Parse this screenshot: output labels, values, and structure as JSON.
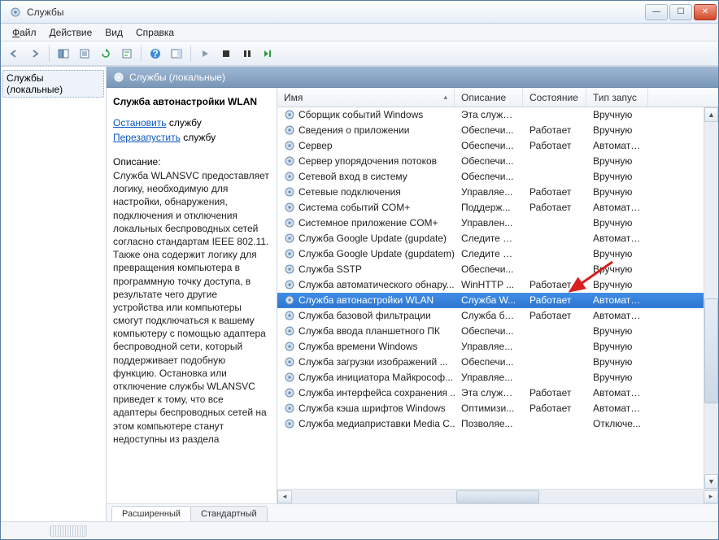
{
  "window": {
    "title": "Службы"
  },
  "menu": {
    "file": "Файл",
    "action": "Действие",
    "view": "Вид",
    "help": "Справка"
  },
  "tree": {
    "node": "Службы (локальные)"
  },
  "header": {
    "title": "Службы (локальные)"
  },
  "detail": {
    "title": "Служба автонастройки WLAN",
    "stop_link": "Остановить",
    "stop_suffix": " службу",
    "restart_link": "Перезапустить",
    "restart_suffix": " службу",
    "desc_label": "Описание:",
    "desc_text": "Служба WLANSVC предоставляет логику, необходимую для настройки, обнаружения, подключения и отключения локальных беспроводных сетей согласно стандартам IEEE 802.11. Также она содержит логику для превращения компьютера в программную точку доступа, в результате чего другие устройства или компьютеры смогут подключаться к вашему компьютеру с помощью адаптера беспроводной сети, который поддерживает подобную функцию. Остановка или отключение службы WLANSVC приведет к тому, что все адаптеры беспроводных сетей на этом компьютере станут недоступны из раздела"
  },
  "columns": {
    "name": "Имя",
    "desc": "Описание",
    "state": "Состояние",
    "start": "Тип запус"
  },
  "rows": [
    {
      "name": "Сборщик событий Windows",
      "desc": "Эта служб...",
      "state": "",
      "start": "Вручную"
    },
    {
      "name": "Сведения о приложении",
      "desc": "Обеспечи...",
      "state": "Работает",
      "start": "Вручную"
    },
    {
      "name": "Сервер",
      "desc": "Обеспечи...",
      "state": "Работает",
      "start": "Автомати..."
    },
    {
      "name": "Сервер упорядочения потоков",
      "desc": "Обеспечи...",
      "state": "",
      "start": "Вручную"
    },
    {
      "name": "Сетевой вход в систему",
      "desc": "Обеспечи...",
      "state": "",
      "start": "Вручную"
    },
    {
      "name": "Сетевые подключения",
      "desc": "Управляе...",
      "state": "Работает",
      "start": "Вручную"
    },
    {
      "name": "Система событий COM+",
      "desc": "Поддерж...",
      "state": "Работает",
      "start": "Автомати..."
    },
    {
      "name": "Системное приложение COM+",
      "desc": "Управлен...",
      "state": "",
      "start": "Вручную"
    },
    {
      "name": "Служба Google Update (gupdate)",
      "desc": "Следите за...",
      "state": "",
      "start": "Автомати..."
    },
    {
      "name": "Служба Google Update (gupdatem)",
      "desc": "Следите за...",
      "state": "",
      "start": "Вручную"
    },
    {
      "name": "Служба SSTP",
      "desc": "Обеспечи...",
      "state": "",
      "start": "Вручную"
    },
    {
      "name": "Служба автоматического обнару...",
      "desc": "WinHTTP ...",
      "state": "Работает",
      "start": "Вручную"
    },
    {
      "name": "Служба автонастройки WLAN",
      "desc": "Служба W...",
      "state": "Работает",
      "start": "Автомати...",
      "selected": true
    },
    {
      "name": "Служба базовой фильтрации",
      "desc": "Служба ба...",
      "state": "Работает",
      "start": "Автомати..."
    },
    {
      "name": "Служба ввода планшетного ПК",
      "desc": "Обеспечи...",
      "state": "",
      "start": "Вручную"
    },
    {
      "name": "Служба времени Windows",
      "desc": "Управляе...",
      "state": "",
      "start": "Вручную"
    },
    {
      "name": "Служба загрузки изображений ...",
      "desc": "Обеспечи...",
      "state": "",
      "start": "Вручную"
    },
    {
      "name": "Служба инициатора Майкрософ...",
      "desc": "Управляе...",
      "state": "",
      "start": "Вручную"
    },
    {
      "name": "Служба интерфейса сохранения ...",
      "desc": "Эта служб...",
      "state": "Работает",
      "start": "Автомати..."
    },
    {
      "name": "Служба кэша шрифтов Windows",
      "desc": "Оптимизи...",
      "state": "Работает",
      "start": "Автомати..."
    },
    {
      "name": "Служба медиаприставки Media C...",
      "desc": "Позволяе...",
      "state": "",
      "start": "Отключе..."
    }
  ],
  "tabs": {
    "extended": "Расширенный",
    "standard": "Стандартный"
  }
}
